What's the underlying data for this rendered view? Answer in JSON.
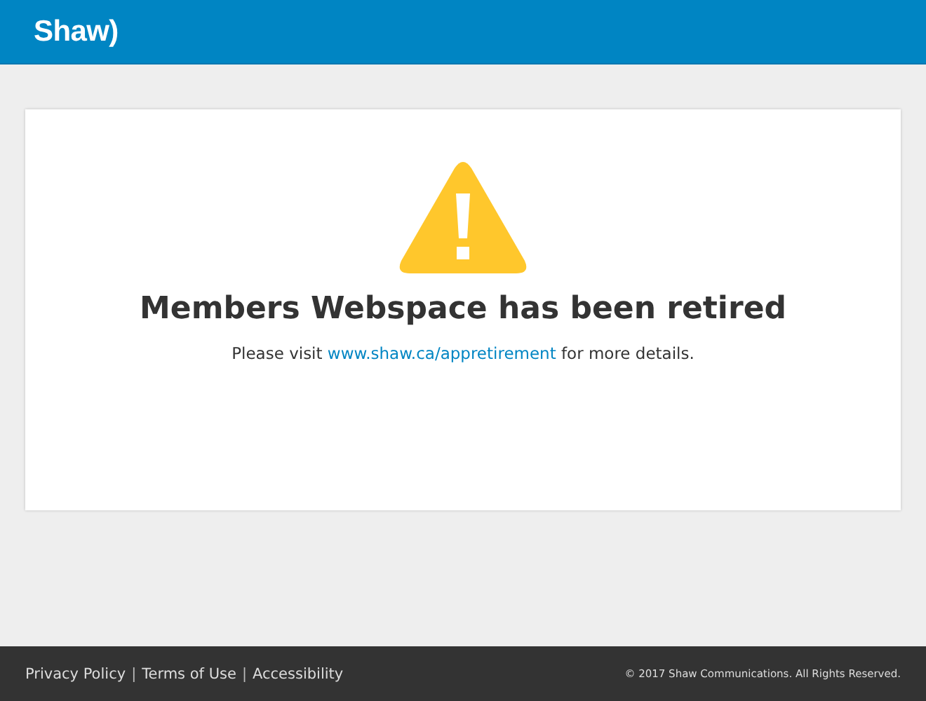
{
  "header": {
    "logo": "Shaw)"
  },
  "notice": {
    "title": "Members Webspace has been retired",
    "before": "Please visit ",
    "link": "www.shaw.ca/appretirement",
    "after": " for more details."
  },
  "footer": {
    "items": [
      {
        "kind": "link",
        "text": "Privacy Policy"
      },
      {
        "kind": "separator",
        "text": "|"
      },
      {
        "kind": "link",
        "text": "Terms of Use"
      },
      {
        "kind": "separator",
        "text": "|"
      },
      {
        "kind": "link",
        "text": "Accessibility"
      }
    ],
    "copyright": "© 2017 Shaw Communications. All Rights Reserved."
  }
}
